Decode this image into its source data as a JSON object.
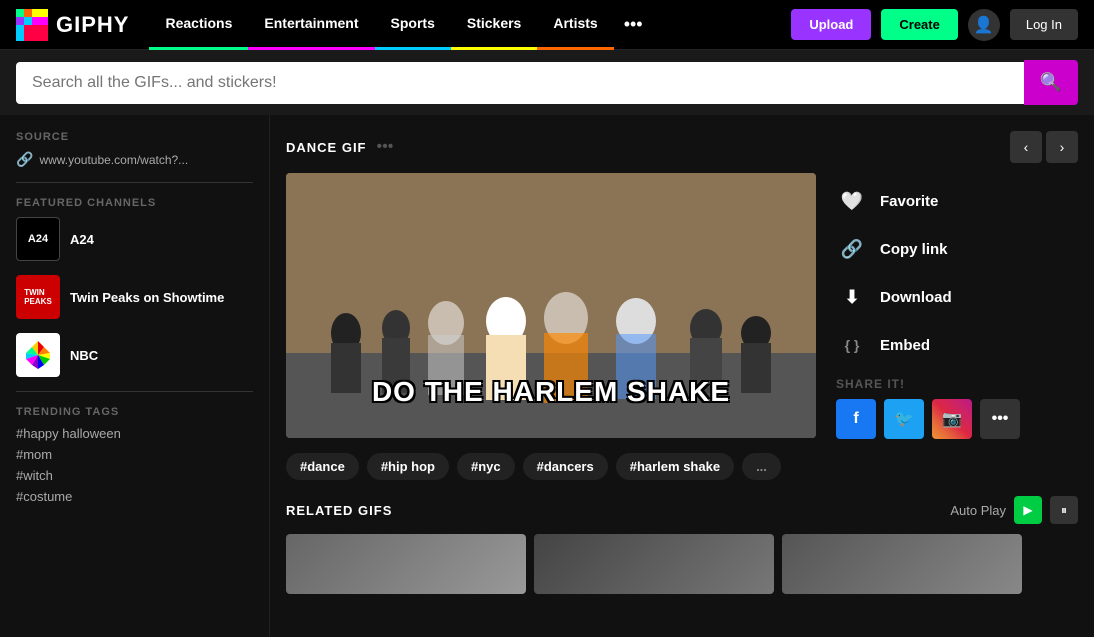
{
  "header": {
    "logo_text": "GIPHY",
    "nav": [
      {
        "label": "Reactions",
        "id": "reactions",
        "active": true,
        "color": "#00ff88"
      },
      {
        "label": "Entertainment",
        "id": "entertainment",
        "active": false,
        "color": "#ff00ff"
      },
      {
        "label": "Sports",
        "id": "sports",
        "active": false,
        "color": "#00ccff"
      },
      {
        "label": "Stickers",
        "id": "stickers",
        "active": false,
        "color": "#ffff00"
      },
      {
        "label": "Artists",
        "id": "artists",
        "active": false,
        "color": "#ff6600"
      }
    ],
    "more_icon": "•••",
    "upload_label": "Upload",
    "create_label": "Create",
    "login_label": "Log In"
  },
  "search": {
    "placeholder": "Search all the GIFs... and stickers!",
    "search_icon": "🔍"
  },
  "sidebar": {
    "source_label": "SOURCE",
    "source_url": "www.youtube.com/watch?...",
    "featured_label": "FEATURED CHANNELS",
    "channels": [
      {
        "name": "A24",
        "abbr": "A24",
        "theme": "a24"
      },
      {
        "name": "Twin Peaks on Showtime",
        "abbr": "TP",
        "theme": "twins"
      },
      {
        "name": "NBC",
        "abbr": "NBC",
        "theme": "nbc"
      }
    ],
    "trending_label": "TRENDING TAGS",
    "tags": [
      "#happy halloween",
      "#mom",
      "#witch",
      "#costume"
    ]
  },
  "gif": {
    "type_label": "DANCE GIF",
    "more_icon": "•••",
    "overlay_text": "DO THE HARLEM SHAKE",
    "actions": [
      {
        "label": "Favorite",
        "icon": "♥"
      },
      {
        "label": "Copy link",
        "icon": "🔗"
      },
      {
        "label": "Download",
        "icon": "⬇"
      },
      {
        "label": "Embed",
        "icon": "{ }"
      }
    ],
    "share_label": "SHARE IT!",
    "share_buttons": [
      {
        "label": "f",
        "platform": "facebook"
      },
      {
        "label": "🐦",
        "platform": "twitter"
      },
      {
        "label": "📷",
        "platform": "instagram"
      },
      {
        "label": "•••",
        "platform": "more"
      }
    ]
  },
  "tags": {
    "pills": [
      "#dance",
      "#hip hop",
      "#nyc",
      "#dancers",
      "#harlem shake",
      "..."
    ]
  },
  "related": {
    "title": "RELATED GIFS",
    "autoplay_label": "Auto Play",
    "play_icon": "▶",
    "pause_icon": "⏸"
  }
}
